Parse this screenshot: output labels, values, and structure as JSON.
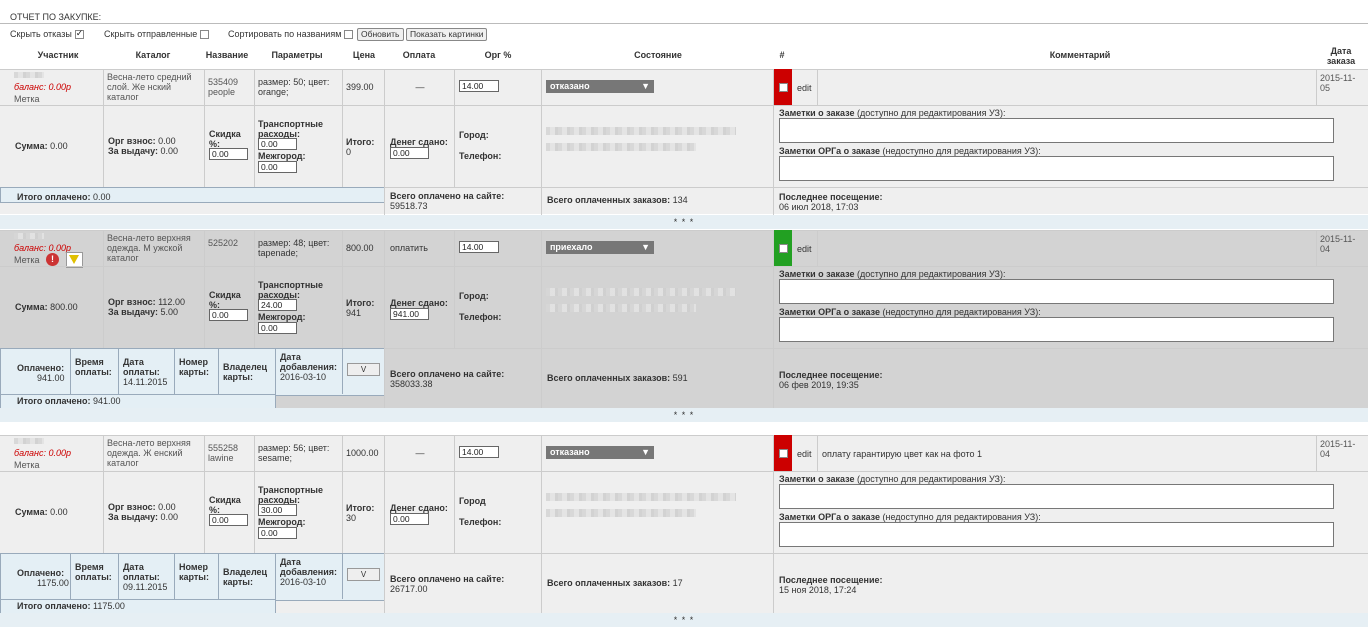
{
  "header": {
    "title": "ОТЧЕТ ПО ЗАКУПКЕ:"
  },
  "controls": {
    "hide_refusals": "Скрыть отказы",
    "hide_sent": "Скрыть отправленные",
    "sort_by_name": "Сортировать по названиям",
    "refresh": "Обновить",
    "show_images": "Показать картинки"
  },
  "columns": {
    "participant": "Участник",
    "catalog": "Каталог",
    "name": "Название",
    "params": "Параметры",
    "price": "Цена",
    "payment": "Оплата",
    "org": "Орг %",
    "state": "Состояние",
    "hash": "#",
    "comment": "Комментарий",
    "date1": "Дата",
    "date2": "заказа"
  },
  "labels": {
    "balance": "баланс:",
    "mark": "Метка",
    "sum": "Сумма:",
    "org_fee": "Орг взнос:",
    "for_issue": "За выдачу:",
    "discount": "Скидка %:",
    "transport": "Транспортные расходы:",
    "intercity": "Межгород:",
    "total": "Итого:",
    "money_given": "Денег сдано:",
    "city": "Город:",
    "city_nocolon": "Город",
    "phone": "Телефон:",
    "notes_title": "Заметки о заказе",
    "notes_hint": "(доступно для редактирования УЗ):",
    "org_notes_title": "Заметки ОРГа о заказе",
    "org_notes_hint": "(недоступно для редактирования УЗ):",
    "total_paid": "Итого оплачено:",
    "total_paid_site": "Всего оплачено на сайте:",
    "total_paid_orders": "Всего оплаченных заказов:",
    "last_visit": "Последнее посещение:",
    "paid": "Оплачено:",
    "pay_time": "Время оплаты:",
    "pay_date": "Дата оплаты:",
    "card_number": "Номер карты:",
    "card_owner": "Владелец карты:",
    "date_added": "Дата добавления:",
    "v": "V",
    "edit": "edit",
    "sep": "* * *"
  },
  "orders": [
    {
      "balance": "0.00р",
      "catalog": "Весна-лето средний слой. Же нский каталог",
      "code": "535409",
      "name2": "people",
      "params": "размер: 50; цвет: orange;",
      "price": "399.00",
      "payment": "—",
      "org": "14.00",
      "state": "отказано",
      "flag_color": "#cc0000",
      "date_line1": "2015-11-",
      "date_line2": "05",
      "comment": "",
      "sum": "0.00",
      "org_fee": "0.00",
      "for_issue": "0.00",
      "discount": "0.00",
      "transport": "0.00",
      "intercity": "0.00",
      "total": "0",
      "money_given": "0.00",
      "total_paid": "0.00",
      "site_paid": "59518.73",
      "paid_orders": "134",
      "last_visit": "06 июл 2018, 17:03"
    },
    {
      "balance": "0.00р",
      "catalog": "Весна-лето верхняя одежда. М ужской каталог",
      "code": "525202",
      "name2": "",
      "params": "размер: 48; цвет: tapenade;",
      "price": "800.00",
      "payment": "оплатить",
      "org": "14.00",
      "state": "приехало",
      "flag_color": "#22a022",
      "date_line1": "2015-11-",
      "date_line2": "04",
      "comment": "",
      "sum": "800.00",
      "org_fee": "112.00",
      "for_issue": "5.00",
      "discount": "0.00",
      "transport": "24.00",
      "intercity": "0.00",
      "total": "941",
      "money_given": "941.00",
      "paid_amount": "941.00",
      "pay_date": "14.11.2015",
      "date_added": "2016-03-10",
      "total_paid": "941.00",
      "site_paid": "358033.38",
      "paid_orders": "591",
      "last_visit": "06 фев 2019, 19:35"
    },
    {
      "balance": "0.00р",
      "catalog": "Весна-лето верхняя одежда. Ж енский каталог",
      "code": "555258",
      "name2": "lawine",
      "params": "размер: 56; цвет: sesame;",
      "price": "1000.00",
      "payment": "—",
      "org": "14.00",
      "state": "отказано",
      "flag_color": "#cc0000",
      "date_line1": "2015-11-",
      "date_line2": "04",
      "comment": "оплату гарантирую цвет как на фото 1",
      "sum": "0.00",
      "org_fee": "0.00",
      "for_issue": "0.00",
      "discount": "0.00",
      "transport": "30.00",
      "intercity": "0.00",
      "total": "30",
      "money_given": "0.00",
      "paid_amount": "1175.00",
      "pay_date": "09.11.2015",
      "date_added": "2016-03-10",
      "total_paid": "1175.00",
      "site_paid": "26717.00",
      "paid_orders": "17",
      "last_visit": "15 ноя 2018, 17:24"
    }
  ]
}
